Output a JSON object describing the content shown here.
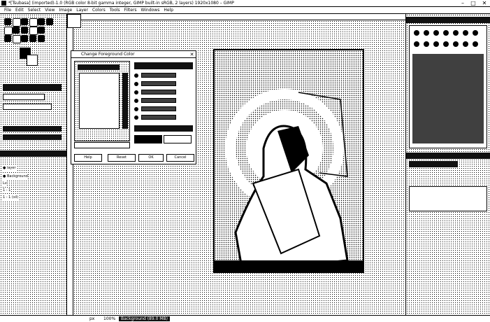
{
  "window": {
    "title": "*[Tsubasa] (imported)-1.0 (RGB color 8-bit gamma integer, GIMP built-in sRGB, 2 layers) 1920x1080 – GIMP",
    "controls": [
      "–",
      "□",
      "✕"
    ]
  },
  "menu": [
    "File",
    "Edit",
    "Select",
    "View",
    "Image",
    "Layer",
    "Colors",
    "Tools",
    "Filters",
    "Windows",
    "Help"
  ],
  "dialog": {
    "title": "Change Foreground Color",
    "buttons": {
      "help": "Help",
      "reset": "Reset",
      "ok": "OK",
      "cancel": "Cancel"
    },
    "hex_label": "HTML notation:"
  },
  "layers": {
    "items": [
      {
        "name": "layer",
        "visible": true
      },
      {
        "name": "Background",
        "visible": true
      }
    ],
    "extra": [
      "Lv",
      "1 - 1",
      "1 - 1 (sil)"
    ]
  },
  "status": {
    "unit": "px",
    "zoom": "100%",
    "message": "Background (89.0 MB)"
  },
  "colors": {
    "accent": "#000000",
    "background": "#ffffff"
  }
}
